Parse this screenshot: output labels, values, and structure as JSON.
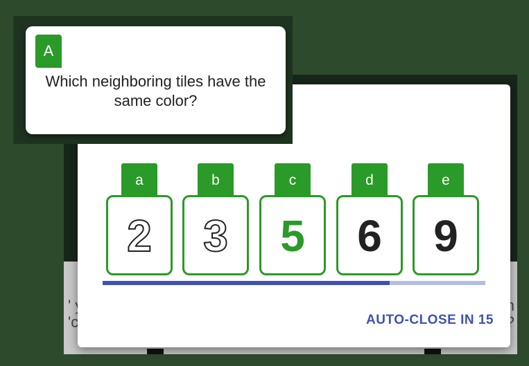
{
  "question": {
    "badge": "A",
    "text": "Which neighboring tiles have the same color?"
  },
  "tiles": [
    {
      "label": "a",
      "value": "2",
      "style": "outline"
    },
    {
      "label": "b",
      "value": "3",
      "style": "outline"
    },
    {
      "label": "c",
      "value": "5",
      "style": "green"
    },
    {
      "label": "d",
      "value": "6",
      "style": "dark"
    },
    {
      "label": "e",
      "value": "9",
      "style": "dark"
    }
  ],
  "dialog": {
    "auto_close_label": "AUTO-CLOSE IN 15",
    "progress_fraction": 0.75
  },
  "background": {
    "left_fragment": "' y\n'c",
    "right_fragment": "n\n?"
  },
  "colors": {
    "accent_green": "#2a9a28",
    "accent_blue": "#3f51b5",
    "page_background": "#2e4a2c"
  }
}
